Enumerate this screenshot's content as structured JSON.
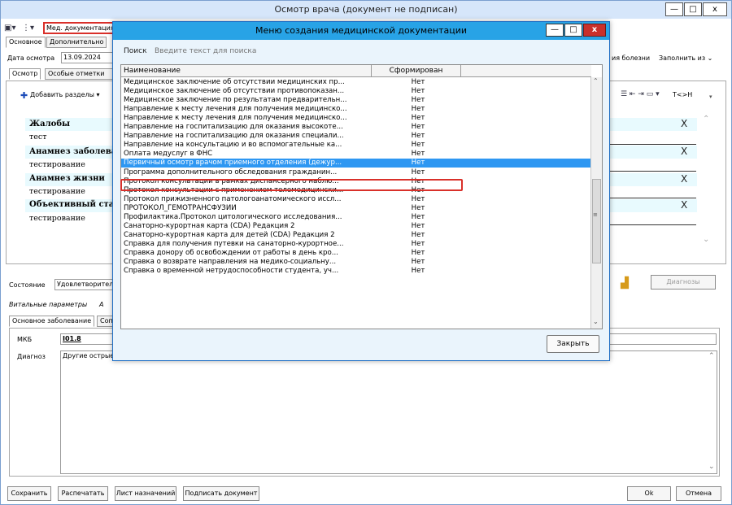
{
  "window": {
    "title": "Осмотр врача (документ не подписан)",
    "min": "—",
    "max": "□",
    "close": "x"
  },
  "toolbar": {
    "med_doc": "Мед. документация"
  },
  "tabs_top": [
    "Основное",
    "Дополнительно"
  ],
  "exam": {
    "date_label": "Дата осмотра",
    "date_value": "13.09.2024",
    "tabs": [
      "Осмотр",
      "Особые отметки"
    ],
    "right_label": "ия болезни",
    "fill_from": "Заполнить из",
    "add_sections": "Добавить разделы",
    "editor_tail": "T<>H"
  },
  "sections": [
    {
      "title": "Жалобы",
      "text": "тест"
    },
    {
      "title": "Анамнез заболеван",
      "text": "тестирование"
    },
    {
      "title": "Анамнез жизни",
      "text": "тестирование"
    },
    {
      "title": "Объективный стат",
      "text": "тестирование"
    }
  ],
  "close_mark": "X",
  "state": {
    "label": "Состояние",
    "value": "Удовлетворитель",
    "vital": "Витальные параметры",
    "vital_tail": "А",
    "diag_button": "Диагнозы"
  },
  "disease_tabs": {
    "main": "Основное заболевание",
    "other": "Соп"
  },
  "mkb": {
    "label": "МКБ",
    "value": "I01.8"
  },
  "diagnosis": {
    "label": "Диагноз",
    "value": "Другие острые"
  },
  "bottom_buttons": {
    "save": "Сохранить",
    "print": "Распечатать",
    "sheet": "Лист назначений",
    "sign": "Подписать документ",
    "ok": "Ok",
    "cancel": "Отмена"
  },
  "dialog": {
    "title": "Меню создания медицинской документации",
    "search_label": "Поиск",
    "search_placeholder": "Введите текст для поиска",
    "col_name": "Наименование",
    "col_formed": "Сформирован",
    "close_button": "Закрыть",
    "rows": [
      {
        "name": "Медицинское заключение об отсутствии медицинских пр...",
        "formed": "Нет"
      },
      {
        "name": "Медицинское заключение об отсутствии противопоказан...",
        "formed": "Нет"
      },
      {
        "name": "Медицинское заключение по результатам предварительн...",
        "formed": "Нет"
      },
      {
        "name": "Направление к месту лечения для получения медицинско...",
        "formed": "Нет"
      },
      {
        "name": "Направление к месту лечения для получения медицинско...",
        "formed": "Нет"
      },
      {
        "name": "Направление на госпитализацию для оказания высокоте...",
        "formed": "Нет"
      },
      {
        "name": "Направление на госпитализацию для оказания специали...",
        "formed": "Нет"
      },
      {
        "name": "Направление на консультацию и во вспомогательные ка...",
        "formed": "Нет"
      },
      {
        "name": "Оплата медуслуг в ФНС",
        "formed": "Нет"
      },
      {
        "name": "Первичный осмотр врачом приемного отделения (дежур...",
        "formed": "Нет",
        "selected": true
      },
      {
        "name": "Программа дополнительного обследования гражданин...",
        "formed": "Нет"
      },
      {
        "name": "Протокол консультации в рамках диспансерного наблю...",
        "formed": "Нет"
      },
      {
        "name": "Протокол консультации с применением телемедицински...",
        "formed": "Нет"
      },
      {
        "name": "Протокол прижизненного патологоанатомического иссл...",
        "formed": "Нет"
      },
      {
        "name": "ПРОТОКОЛ_ГЕМОТРАНСФУЗИИ",
        "formed": "Нет"
      },
      {
        "name": "Профилактика.Протокол цитологического исследования...",
        "formed": "Нет"
      },
      {
        "name": "Санаторно-курортная карта (CDA) Редакция 2",
        "formed": "Нет"
      },
      {
        "name": "Санаторно-курортная карта для детей (CDA) Редакция 2",
        "formed": "Нет"
      },
      {
        "name": "Справка для получения путевки на санаторно-курортное...",
        "formed": "Нет"
      },
      {
        "name": "Справка донору об освобождении от работы в день кро...",
        "formed": "Нет"
      },
      {
        "name": "Справка о возврате направления на медико-социальну...",
        "formed": "Нет"
      },
      {
        "name": "Справка о временной нетрудоспособности студента, уч...",
        "formed": "Нет"
      }
    ]
  }
}
